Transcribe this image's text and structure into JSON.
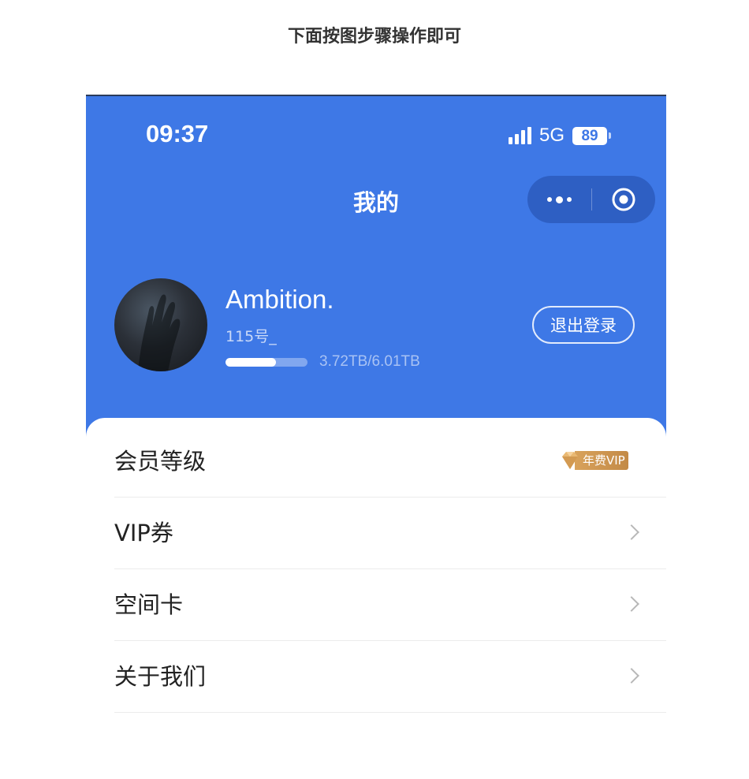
{
  "instruction": "下面按图步骤操作即可",
  "status_bar": {
    "time": "09:37",
    "network": "5G",
    "battery": "89"
  },
  "nav": {
    "title": "我的",
    "more_icon": "more-dots-icon",
    "close_icon": "target-circle-icon"
  },
  "profile": {
    "username": "Ambition.",
    "account_id": "115号_",
    "storage_text": "3.72TB/6.01TB",
    "storage_used_fraction": 0.62,
    "logout_label": "退出登录"
  },
  "menu": {
    "items": [
      {
        "label": "会员等级",
        "badge": "年费VIP"
      },
      {
        "label": "VIP券"
      },
      {
        "label": "空间卡"
      },
      {
        "label": "关于我们"
      }
    ]
  },
  "colors": {
    "header_blue": "#3e78e6",
    "vip_gold": "#c38a46"
  }
}
